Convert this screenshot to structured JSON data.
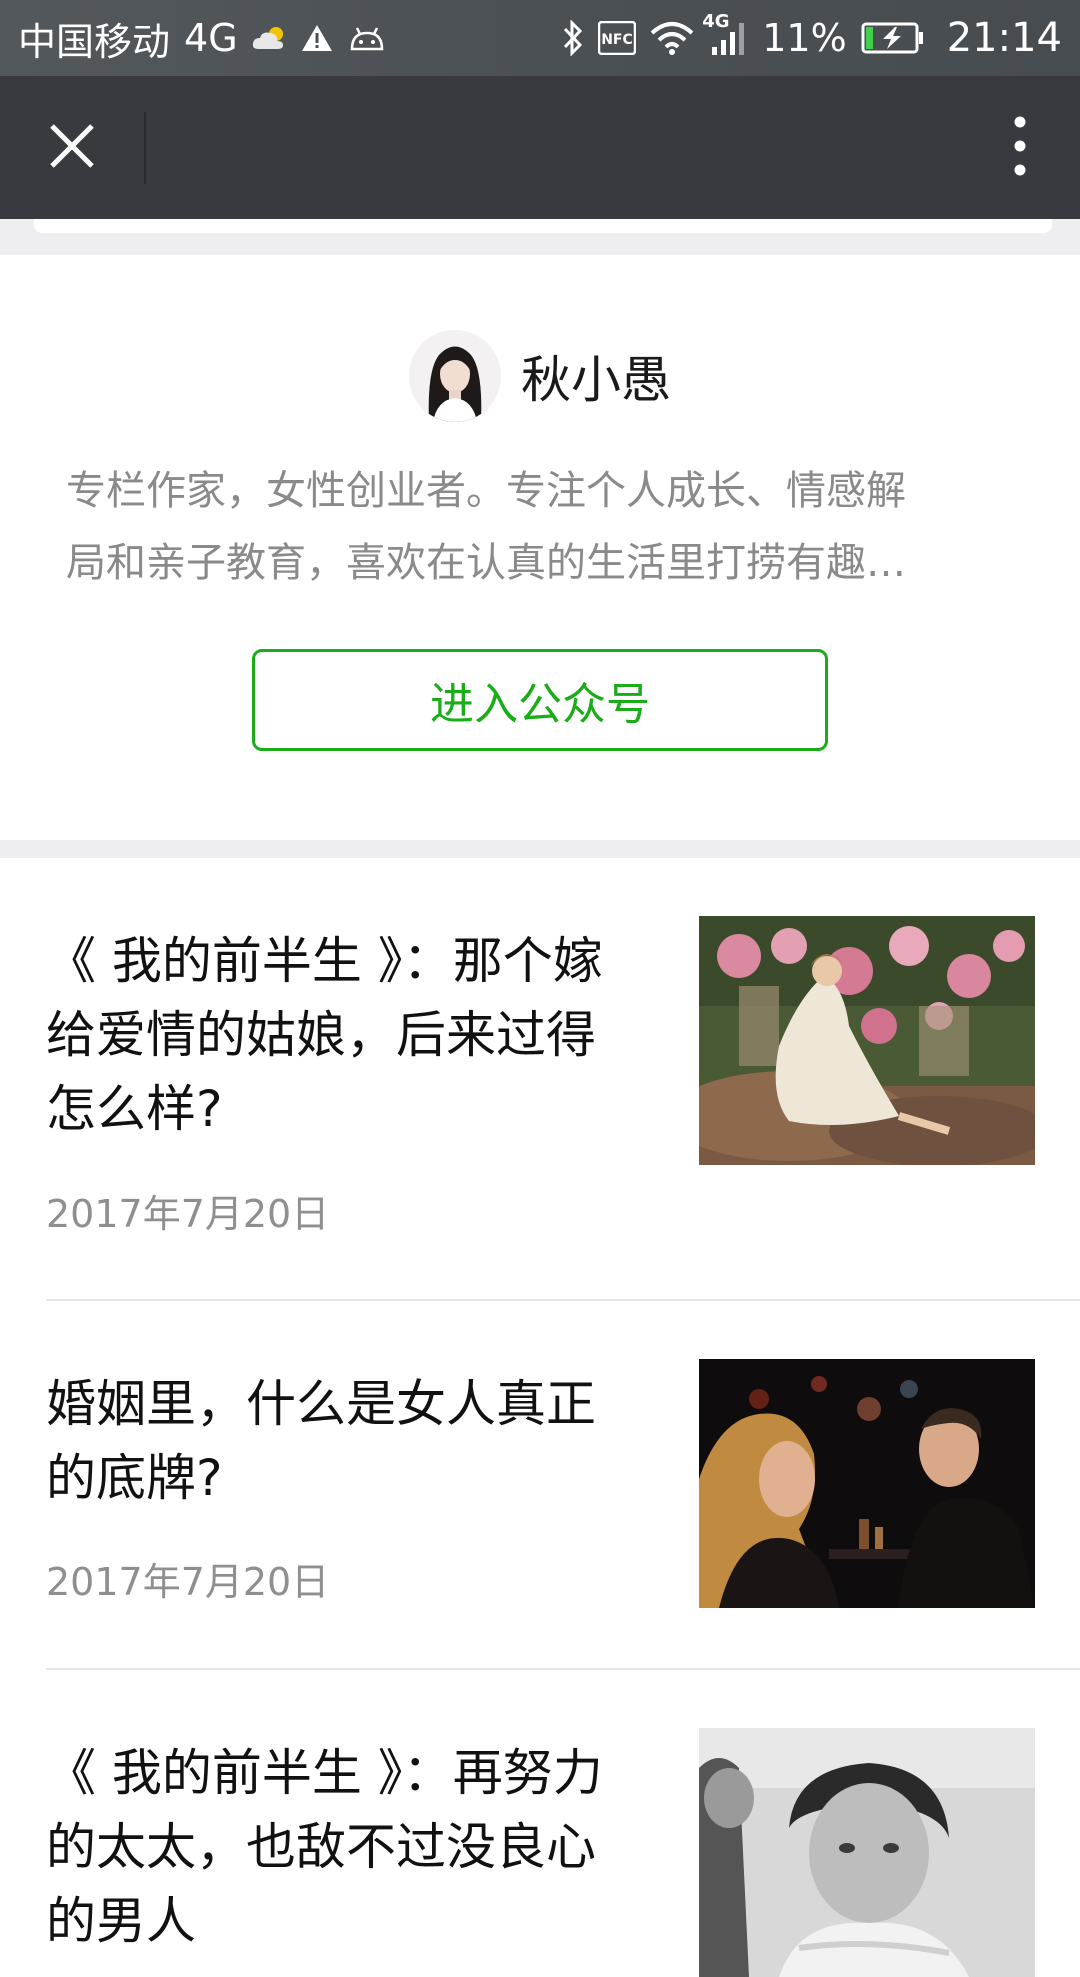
{
  "status_bar": {
    "carrier": "中国移动",
    "network": "4G",
    "signal_network": "4G",
    "battery_percent": "11%",
    "time": "21:14",
    "icons": [
      "weather-cloudy-icon",
      "warning-icon",
      "android-debug-icon",
      "bluetooth-icon",
      "nfc-icon",
      "wifi-icon",
      "cell-signal-icon",
      "battery-charging-icon"
    ]
  },
  "nav": {
    "close_icon": "close-icon",
    "more_icon": "more-vertical-icon"
  },
  "profile": {
    "name": "秋小愚",
    "description_line1": "专栏作家，女性创业者。专注个人成长、情感解",
    "description_line2": "局和亲子教育，喜欢在认真的生活里打捞有趣…",
    "follow_button_label": "进入公众号"
  },
  "articles": [
    {
      "title_line1": "《 我的前半生 》：那个嫁",
      "title_line2": "给爱情的姑娘，后来过得",
      "title_line3": "怎么样?",
      "date": "2017年7月20日"
    },
    {
      "title_line1": "婚姻里，什么是女人真正",
      "title_line2": "的底牌?",
      "title_line3": "",
      "date": "2017年7月20日"
    },
    {
      "title_line1": "《 我的前半生 》：再努力",
      "title_line2": "的太太，也敌不过没良心",
      "title_line3": "的男人",
      "date": ""
    }
  ],
  "colors": {
    "accent_green": "#1aad19",
    "nav_bg": "#393a3f",
    "status_bg": "#4b5055",
    "divider_bg": "#eeeef1"
  }
}
